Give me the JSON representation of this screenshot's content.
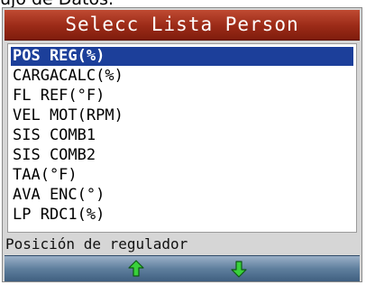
{
  "page_title_cut": "ujo de Datos.",
  "header": {
    "title": "Selecc Lista Person"
  },
  "list": {
    "items": [
      {
        "label": "POS REG(%)",
        "selected": true
      },
      {
        "label": "CARGACALC(%)",
        "selected": false
      },
      {
        "label": "FL REF(°F)",
        "selected": false
      },
      {
        "label": "VEL MOT(RPM)",
        "selected": false
      },
      {
        "label": "SIS COMB1",
        "selected": false
      },
      {
        "label": "SIS COMB2",
        "selected": false
      },
      {
        "label": "TAA(°F)",
        "selected": false
      },
      {
        "label": "AVA ENC(°)",
        "selected": false
      },
      {
        "label": "LP RDC1(%)",
        "selected": false
      }
    ]
  },
  "status": {
    "text": "Posición de regulador"
  },
  "bottom_bar": {
    "up_icon": "up-arrow-icon",
    "down_icon": "down-arrow-icon"
  },
  "colors": {
    "header": "#9b2a17",
    "selection": "#1c3f9a",
    "arrow_fill": "#39d13a",
    "bottom_bar": "#5f7f9d"
  }
}
